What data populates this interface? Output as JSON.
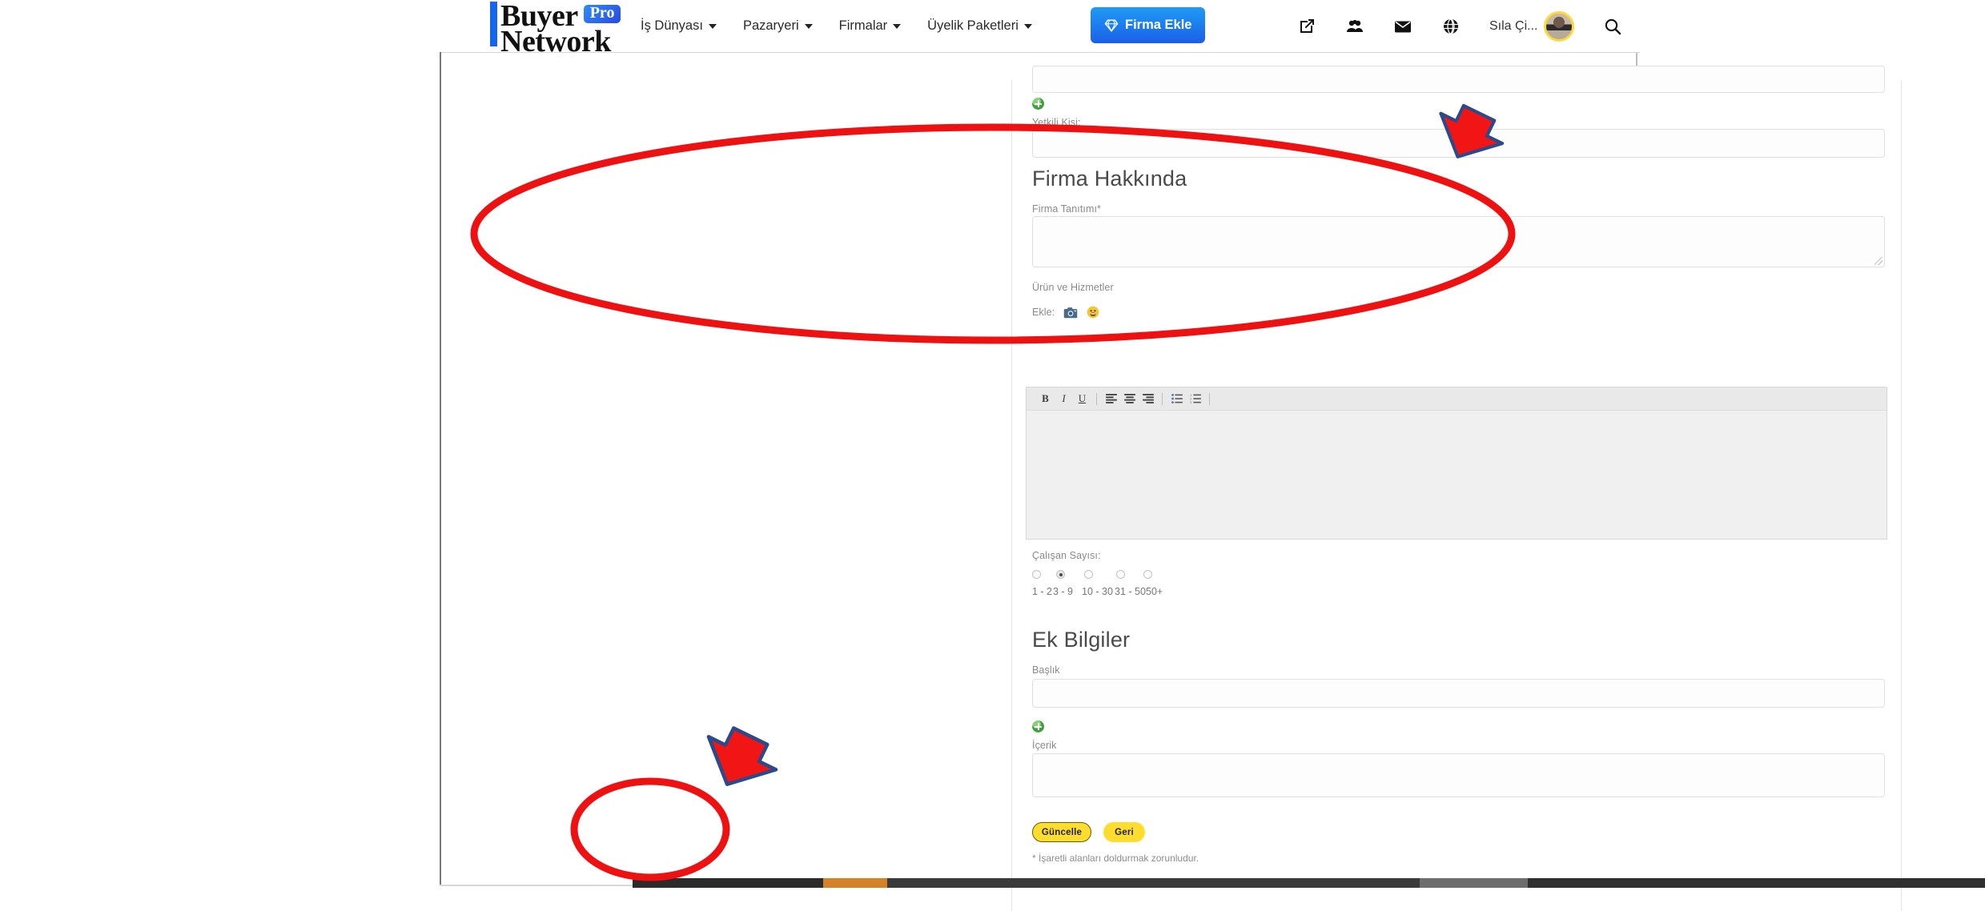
{
  "navbar": {
    "brand": {
      "word1": "Buyer",
      "badge": "Pro",
      "word2": "Network"
    },
    "links": [
      {
        "label": "İş Dünyası",
        "icon": "chevron-down-icon"
      },
      {
        "label": "Pazaryeri",
        "icon": "chevron-down-icon"
      },
      {
        "label": "Firmalar",
        "icon": "chevron-down-icon"
      },
      {
        "label": "Üyelik Paketleri",
        "icon": "chevron-down-icon"
      }
    ],
    "cta": {
      "label": "Firma Ekle",
      "icon": "diamond-icon",
      "color": "#1b6ce8"
    },
    "icons": [
      "external-link-icon",
      "users-icon",
      "envelope-icon",
      "globe-icon"
    ],
    "username": "Sıla Çi...",
    "avatar": "user-avatar",
    "search_icon": "search-icon"
  },
  "form": {
    "authorized_person_label": "Yetkili Kişi:",
    "add_icon_label": "add-circle-icon",
    "about_heading": "Firma Hakkında",
    "company_intro_label": "Firma Tanıtımı*",
    "products_services_label": "Ürün ve Hizmetler",
    "insert_label": "Ekle:",
    "insert_icons": [
      "camera-icon",
      "emoji-icon"
    ],
    "editor": {
      "bold": "B",
      "italic": "I",
      "underline": "U",
      "align_left": "align-left-icon",
      "align_center": "align-center-icon",
      "align_right": "align-right-icon",
      "bullet_list": "bullet-list-icon",
      "numbered_list": "numbered-list-icon",
      "content": ""
    },
    "employee_count_label": "Çalışan Sayısı:",
    "employee_options": [
      "1 - 2",
      "3 - 9",
      "10 - 30",
      "31 - 50",
      "50+"
    ],
    "employee_selected_index": 1,
    "extra_heading": "Ek Bilgiler",
    "title_label": "Başlık",
    "title_value": "",
    "content_label": "İçerik",
    "content_value": "",
    "intro_value": "",
    "authorized_person_value": "",
    "buttons": {
      "submit": "Güncelle",
      "back": "Geri",
      "accent": "#ffdd2e"
    },
    "required_note": "* İşaretli alanları doldurmak zorunludur."
  },
  "annotations": {
    "ellipse_top": "highlight-ellipse-about-section",
    "ellipse_bottom": "highlight-ellipse-buttons",
    "arrow_top": "pointer-arrow-right",
    "arrow_bottom": "pointer-arrow-content",
    "stroke": "#ee1111",
    "arrow_outline": "#2b4a8b"
  }
}
